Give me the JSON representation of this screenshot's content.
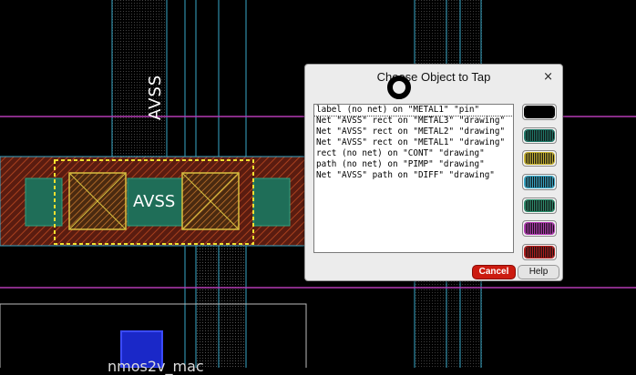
{
  "layout_labels": {
    "avss_vertical": "AVSS",
    "avss_center": "AVSS",
    "bottom_label": "nmos2v_mac"
  },
  "dialog": {
    "title": "Choose Object to Tap",
    "close_glyph": "×",
    "items": [
      "label (no net) on \"METAL1\" \"pin\"",
      "Net \"AVSS\" rect on \"METAL3\" \"drawing\"",
      "Net \"AVSS\" rect on \"METAL2\" \"drawing\"",
      "Net \"AVSS\" rect on \"METAL1\" \"drawing\"",
      "rect (no net) on \"CONT\" \"drawing\"",
      "path (no net) on \"PIMP\" \"drawing\"",
      "Net \"AVSS\" path on \"DIFF\" \"drawing\""
    ],
    "swatch_colors": [
      "#000000",
      "#1f7a6a",
      "#c8b432",
      "#38a8c8",
      "#2e8f6e",
      "#b43ab4",
      "#b41e1e"
    ],
    "cancel_label": "Cancel",
    "help_label": "Help"
  }
}
